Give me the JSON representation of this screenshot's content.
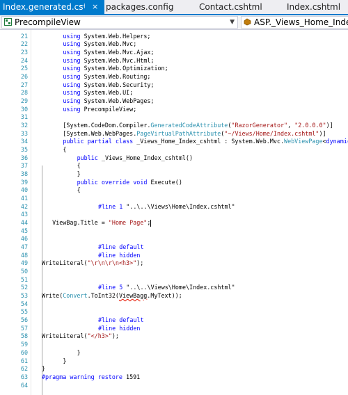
{
  "tabs": [
    {
      "label": "Index.generated.cs",
      "pin": "⊣",
      "close": "×",
      "active": true
    },
    {
      "label": "packages.config",
      "active": false
    },
    {
      "label": "Contact.cshtml",
      "active": false
    },
    {
      "label": "Index.cshtml",
      "active": false
    }
  ],
  "nav": {
    "project": "PrecompileView",
    "type": "ASP._Views_Home_Index_"
  },
  "lines": [
    {
      "n": "21",
      "i": 6,
      "t": [
        [
          "kw",
          "using"
        ],
        [
          "",
          "System.Web.Helpers;"
        ]
      ]
    },
    {
      "n": "22",
      "i": 6,
      "t": [
        [
          "kw",
          "using"
        ],
        [
          "",
          "System.Web.Mvc;"
        ]
      ]
    },
    {
      "n": "23",
      "i": 6,
      "t": [
        [
          "kw",
          "using"
        ],
        [
          "",
          "System.Web.Mvc.Ajax;"
        ]
      ]
    },
    {
      "n": "24",
      "i": 6,
      "t": [
        [
          "kw",
          "using"
        ],
        [
          "",
          "System.Web.Mvc.Html;"
        ]
      ]
    },
    {
      "n": "25",
      "i": 6,
      "t": [
        [
          "kw",
          "using"
        ],
        [
          "",
          "System.Web.Optimization;"
        ]
      ]
    },
    {
      "n": "26",
      "i": 6,
      "t": [
        [
          "kw",
          "using"
        ],
        [
          "",
          "System.Web.Routing;"
        ]
      ]
    },
    {
      "n": "27",
      "i": 6,
      "t": [
        [
          "kw",
          "using"
        ],
        [
          "",
          "System.Web.Security;"
        ]
      ]
    },
    {
      "n": "28",
      "i": 6,
      "t": [
        [
          "kw",
          "using"
        ],
        [
          "",
          "System.Web.UI;"
        ]
      ]
    },
    {
      "n": "29",
      "i": 6,
      "t": [
        [
          "kw",
          "using"
        ],
        [
          "",
          "System.Web.WebPages;"
        ]
      ]
    },
    {
      "n": "30",
      "i": 6,
      "t": [
        [
          "kw",
          "using"
        ],
        [
          "",
          "PrecompileView;"
        ]
      ]
    },
    {
      "n": "31",
      "i": 0,
      "t": []
    },
    {
      "n": "32",
      "i": 6,
      "t": [
        [
          "",
          "[System.CodeDom.Compiler."
        ],
        [
          "ty",
          "GeneratedCodeAttribute"
        ],
        [
          "",
          "("
        ],
        [
          "st",
          "\"RazorGenerator\""
        ],
        [
          "",
          ", "
        ],
        [
          "st",
          "\"2.0.0.0\""
        ],
        [
          "",
          ")]"
        ]
      ]
    },
    {
      "n": "33",
      "i": 6,
      "t": [
        [
          "",
          "[System.Web.WebPages."
        ],
        [
          "ty",
          "PageVirtualPathAttribute"
        ],
        [
          "",
          "("
        ],
        [
          "st",
          "\"~/Views/Home/Index.cshtml\""
        ],
        [
          "",
          ")]"
        ]
      ]
    },
    {
      "n": "34",
      "i": 6,
      "t": [
        [
          "kw",
          "public partial class"
        ],
        [
          "",
          "_Views_Home_Index_cshtml : System.Web.Mvc."
        ],
        [
          "ty",
          "WebViewPage"
        ],
        [
          "",
          "<"
        ],
        [
          "kw",
          "dynamic"
        ],
        [
          "",
          ">"
        ]
      ]
    },
    {
      "n": "35",
      "i": 6,
      "t": [
        [
          "",
          "{"
        ]
      ]
    },
    {
      "n": "36",
      "i": 10,
      "t": [
        [
          "kw",
          "public"
        ],
        [
          "",
          "_Views_Home_Index_cshtml()"
        ]
      ]
    },
    {
      "n": "37",
      "i": 10,
      "t": [
        [
          "",
          "{"
        ]
      ]
    },
    {
      "n": "38",
      "i": 10,
      "t": [
        [
          "",
          "}"
        ]
      ]
    },
    {
      "n": "39",
      "i": 10,
      "t": [
        [
          "kw",
          "public override void"
        ],
        [
          "",
          "Execute()"
        ]
      ]
    },
    {
      "n": "40",
      "i": 10,
      "t": [
        [
          "",
          "{"
        ]
      ]
    },
    {
      "n": "41",
      "i": 0,
      "t": []
    },
    {
      "n": "42",
      "i": 16,
      "t": [
        [
          "pp",
          "#line 1"
        ],
        [
          "",
          "\"..\\..\\Views\\Home\\Index.cshtml\""
        ]
      ]
    },
    {
      "n": "43",
      "i": 0,
      "t": []
    },
    {
      "n": "44",
      "i": 3,
      "t": [
        [
          "",
          "ViewBag.Title = "
        ],
        [
          "st",
          "\"Home Page\""
        ],
        [
          "",
          ";"
        ],
        [
          "caret",
          ""
        ]
      ]
    },
    {
      "n": "45",
      "i": 0,
      "t": []
    },
    {
      "n": "46",
      "i": 0,
      "t": []
    },
    {
      "n": "47",
      "i": 16,
      "t": [
        [
          "pp",
          "#line default"
        ]
      ]
    },
    {
      "n": "48",
      "i": 16,
      "t": [
        [
          "pp",
          "#line hidden"
        ]
      ]
    },
    {
      "n": "49",
      "i": 0,
      "t": [
        [
          "",
          "WriteLiteral("
        ],
        [
          "st",
          "\"\\r\\n\\r\\n<h3>\""
        ],
        [
          "",
          ");"
        ]
      ]
    },
    {
      "n": "50",
      "i": 0,
      "t": []
    },
    {
      "n": "51",
      "i": 0,
      "t": []
    },
    {
      "n": "52",
      "i": 16,
      "t": [
        [
          "pp",
          "#line 5"
        ],
        [
          "",
          "\"..\\..\\Views\\Home\\Index.cshtml\""
        ]
      ]
    },
    {
      "n": "53",
      "i": 0,
      "t": [
        [
          "",
          "Write("
        ],
        [
          "ty",
          "Convert"
        ],
        [
          "",
          ".ToInt32("
        ],
        [
          "squig",
          "ViewBagg"
        ],
        [
          "",
          ".MyText));"
        ]
      ]
    },
    {
      "n": "54",
      "i": 0,
      "t": []
    },
    {
      "n": "55",
      "i": 0,
      "t": []
    },
    {
      "n": "56",
      "i": 16,
      "t": [
        [
          "pp",
          "#line default"
        ]
      ]
    },
    {
      "n": "57",
      "i": 16,
      "t": [
        [
          "pp",
          "#line hidden"
        ]
      ]
    },
    {
      "n": "58",
      "i": 0,
      "t": [
        [
          "",
          "WriteLiteral("
        ],
        [
          "st",
          "\"</h3>\""
        ],
        [
          "",
          ");"
        ]
      ]
    },
    {
      "n": "59",
      "i": 0,
      "t": []
    },
    {
      "n": "60",
      "i": 10,
      "t": [
        [
          "",
          "}"
        ]
      ]
    },
    {
      "n": "61",
      "i": 6,
      "t": [
        [
          "",
          "}"
        ]
      ]
    },
    {
      "n": "62",
      "i": 0,
      "t": [
        [
          "",
          "}"
        ]
      ]
    },
    {
      "n": "63",
      "i": 0,
      "t": [
        [
          "pp",
          "#pragma warning restore"
        ],
        [
          "",
          "1591"
        ]
      ]
    },
    {
      "n": "64",
      "i": 0,
      "t": []
    }
  ]
}
